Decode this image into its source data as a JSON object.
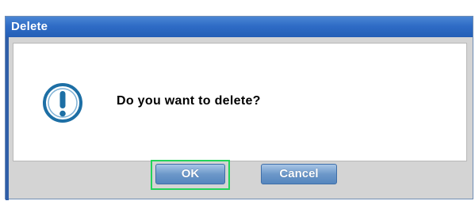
{
  "dialog": {
    "title": "Delete",
    "message": "Do you want to delete?",
    "icon": "exclamation-info-icon",
    "ok_label": "OK",
    "cancel_label": "Cancel",
    "colors": {
      "titlebar": "#2f6cc6",
      "button": "#6d98c9",
      "focus_outline": "#22d35a",
      "icon": "#1d6fa5"
    }
  }
}
